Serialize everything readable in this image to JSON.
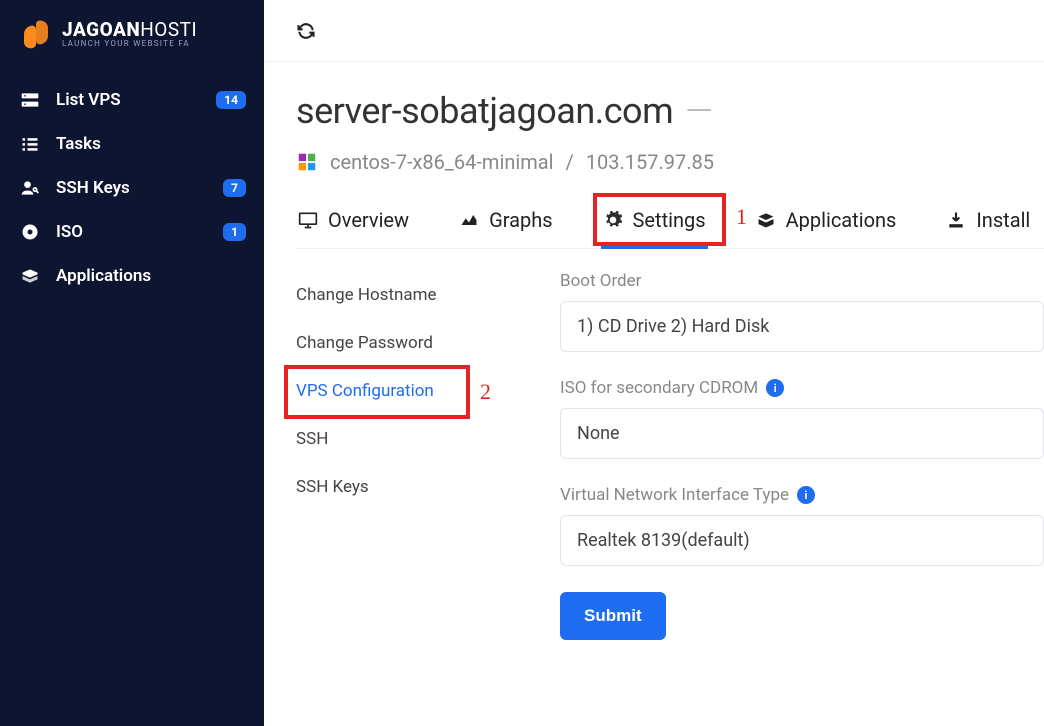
{
  "brand": {
    "name_bold": "JAGOAN",
    "name_thin": "HOSTI",
    "tagline": "LAUNCH YOUR WEBSITE FA"
  },
  "sidebar": {
    "items": [
      {
        "label": "List VPS",
        "badge": "14"
      },
      {
        "label": "Tasks",
        "badge": ""
      },
      {
        "label": "SSH Keys",
        "badge": "7"
      },
      {
        "label": "ISO",
        "badge": "1"
      },
      {
        "label": "Applications",
        "badge": ""
      }
    ]
  },
  "page": {
    "title": "server-sobatjagoan.com",
    "os": "centos-7-x86_64-minimal",
    "ip": "103.157.97.85"
  },
  "tabs": {
    "overview": "Overview",
    "graphs": "Graphs",
    "settings": "Settings",
    "applications": "Applications",
    "install": "Install"
  },
  "annotations": {
    "one": "1",
    "two": "2"
  },
  "settings_menu": {
    "items": [
      {
        "label": "Change Hostname"
      },
      {
        "label": "Change Password"
      },
      {
        "label": "VPS Configuration"
      },
      {
        "label": "SSH"
      },
      {
        "label": "SSH Keys"
      }
    ]
  },
  "form": {
    "boot_order_label": "Boot Order",
    "boot_order_value": "1) CD Drive 2) Hard Disk",
    "iso_label": "ISO for secondary CDROM",
    "iso_value": "None",
    "nic_label": "Virtual Network Interface Type",
    "nic_value": "Realtek 8139(default)",
    "submit": "Submit"
  }
}
